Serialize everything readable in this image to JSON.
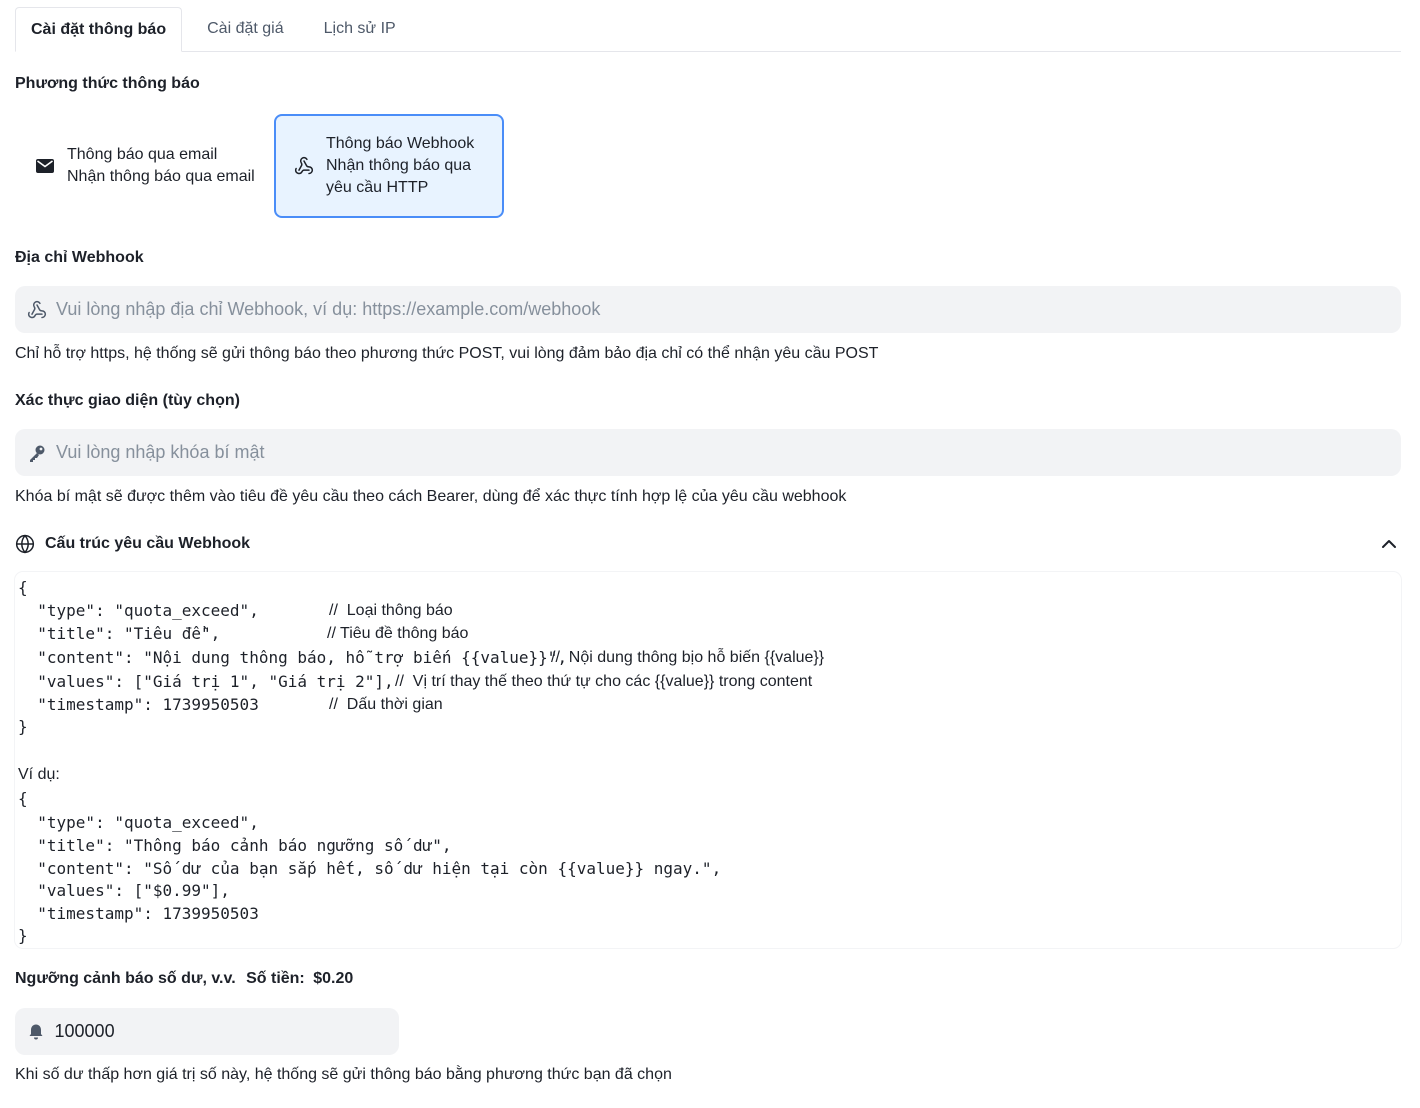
{
  "tabs": [
    {
      "label": "Cài đặt thông báo"
    },
    {
      "label": "Cài đặt giá"
    },
    {
      "label": "Lịch sử IP"
    }
  ],
  "method": {
    "label": "Phương thức thông báo",
    "email": {
      "title": "Thông báo qua email",
      "desc": "Nhận thông báo qua email",
      "icon": "mail-icon"
    },
    "webhook": {
      "title": "Thông báo Webhook",
      "desc1": "Nhận thông báo qua",
      "desc2": "yêu cầu HTTP",
      "icon": "webhook-icon",
      "selected": true
    }
  },
  "webhook_url": {
    "label": "Địa chỉ Webhook",
    "placeholder": "Vui lòng nhập địa chỉ Webhook, ví dụ: https://example.com/webhook",
    "value": "",
    "help": "Chỉ hỗ trợ https, hệ thống sẽ gửi thông báo theo phương thức POST, vui lòng đảm bảo địa chỉ có thể nhận yêu cầu POST"
  },
  "secret": {
    "label": "Xác thực giao diện (tùy chọn)",
    "placeholder": "Vui lòng nhập khóa bí mật",
    "value": "",
    "help": "Khóa bí mật sẽ được thêm vào tiêu đề yêu cầu theo cách Bearer, dùng để xác thực tính hợp lệ của yêu cầu webhook"
  },
  "structure": {
    "title": "Cấu trúc yêu cầu Webhook",
    "open_brace": "{",
    "close_brace": "}",
    "lines": [
      {
        "code": "  \"type\": \"quota_exceed\",",
        "comment": "//  Loại thông báo"
      },
      {
        "code": "  \"title\": \"Tiêu đề\",",
        "comment": "// Tiêu đề thông báo"
      },
      {
        "code": "  \"content\": \"Nội dung thông báo, hỗ trợ biến {{value}}\",",
        "comment": "//  Nội dung thông bịo hỗ biến {{value}}"
      },
      {
        "code": "  \"values\": [\"Giá trị 1\", \"Giá trị 2\"],",
        "comment": "//  Vị trí thay thế theo thứ tự cho các {{value}} trong content"
      },
      {
        "code": "  \"timestamp\": 1739950503",
        "comment": "//  Dấu thời gian"
      }
    ],
    "example_label": "Ví dụ:",
    "example_lines": [
      "  \"type\": \"quota_exceed\",",
      "  \"title\": \"Thông báo cảnh báo ngưỡng số dư\",",
      "  \"content\": \"Số dư của bạn sắp hết, số dư hiện tại còn {{value}} ngay.\",",
      "  \"values\": [\"$0.99\"],",
      "  \"timestamp\": 1739950503"
    ]
  },
  "threshold": {
    "label": "Ngưỡng cảnh báo số dư, v.v.",
    "amount_label": "Số tiền:",
    "amount": "$0.20",
    "value": "100000",
    "help": "Khi số dư thấp hơn giá trị số này, hệ thống sẽ gửi thông báo bằng phương thức bạn đã chọn"
  },
  "colors": {
    "accent": "#4a8df8",
    "selected_bg": "#e8f3ff",
    "input_bg": "#f2f3f5"
  }
}
